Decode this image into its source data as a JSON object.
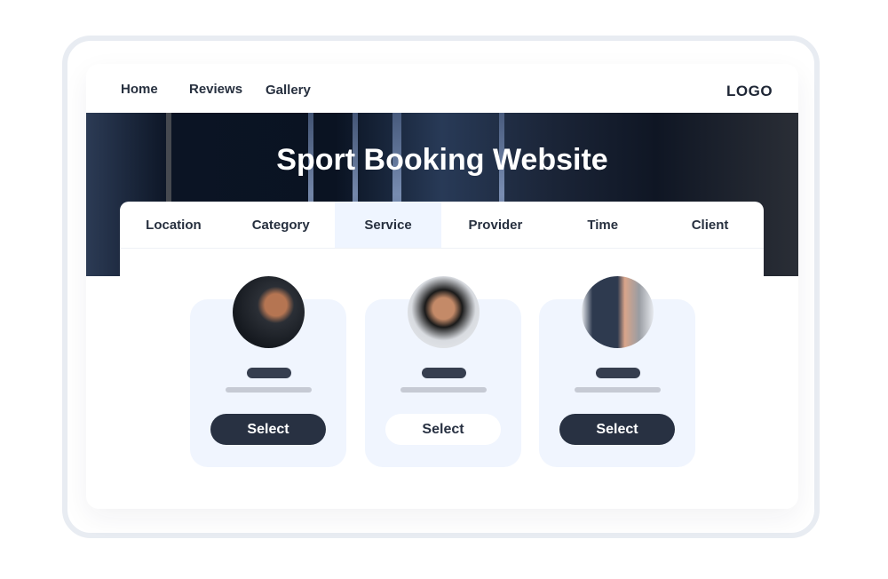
{
  "nav": {
    "items": [
      "Home",
      "Reviews",
      "Gallery"
    ],
    "logo": "LOGO"
  },
  "hero": {
    "title": "Sport Booking Website"
  },
  "tabs": {
    "items": [
      "Location",
      "Category",
      "Service",
      "Provider",
      "Time",
      "Client"
    ],
    "active": "Service"
  },
  "cards": [
    {
      "image": "athlete-gripping-rope-photo",
      "button": "Select",
      "button_style": "dark"
    },
    {
      "image": "woman-on-treadmill-photo",
      "button": "Select",
      "button_style": "light"
    },
    {
      "image": "trainer-with-client-tablet-photo",
      "button": "Select",
      "button_style": "dark"
    }
  ],
  "colors": {
    "dark": "#283142",
    "card_bg": "#f0f5fe",
    "active_tab": "#eff5ff",
    "frame": "#e8ecf2"
  }
}
